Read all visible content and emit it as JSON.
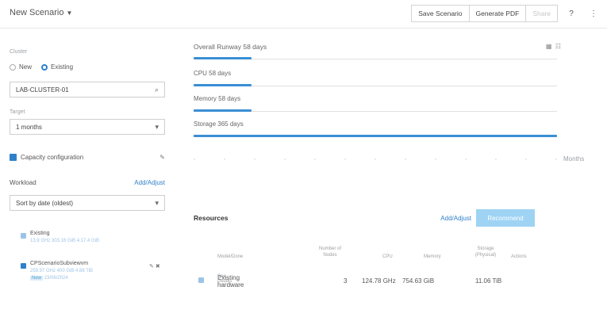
{
  "topbar": {
    "scenario_title": "New Scenario",
    "save_label": "Save Scenario",
    "pdf_label": "Generate PDF",
    "share_label": "Share",
    "help_icon": "?"
  },
  "sidebar": {
    "cluster_label": "Cluster",
    "radio_new": "New",
    "radio_existing": "Existing",
    "cluster_value": "LAB-CLUSTER-01",
    "target_label": "Target",
    "target_value": "1 months",
    "capacity_label": "Capacity configuration",
    "workload_label": "Workload",
    "add_adjust": "Add/Adjust",
    "sort_value": "Sort by date (oldest)",
    "workloads": [
      {
        "name": "Existing",
        "detail": "13.9 GHz   303.16 GiB   4.17.4 GiB"
      },
      {
        "name": "CPScenarioSubviewvm",
        "detail": "259.97 GHz   400 GiB   4.88 TiB",
        "tag": "New",
        "date": "23/06/2024"
      }
    ]
  },
  "chart": {
    "title": "Overall Runway 58 days",
    "rows": [
      {
        "label": "CPU 58 days",
        "fraction": 0.16
      },
      {
        "label": "Memory 58 days",
        "fraction": 0.16
      },
      {
        "label": "Storage 365 days",
        "fraction": 1.0
      }
    ],
    "overall_fraction": 0.16,
    "x_axis_label": "Months"
  },
  "resources": {
    "title": "Resources",
    "add_adjust": "Add/Adjust",
    "recommend": "Recommend",
    "columns": [
      "Model/Done",
      "Number of Nodes",
      "CPU",
      "Memory",
      "Storage (Physical)",
      "Actions"
    ],
    "rows": [
      {
        "name": "Existing hardware",
        "sub": "See Details",
        "nodes": "3",
        "cpu": "124.78 GHz",
        "memory": "754.63 GiB",
        "storage": "11.06 TiB"
      }
    ]
  },
  "colors": {
    "accent": "#2f80c9",
    "bar": "#3a8fd4",
    "button_primary": "#9ed3f4"
  }
}
